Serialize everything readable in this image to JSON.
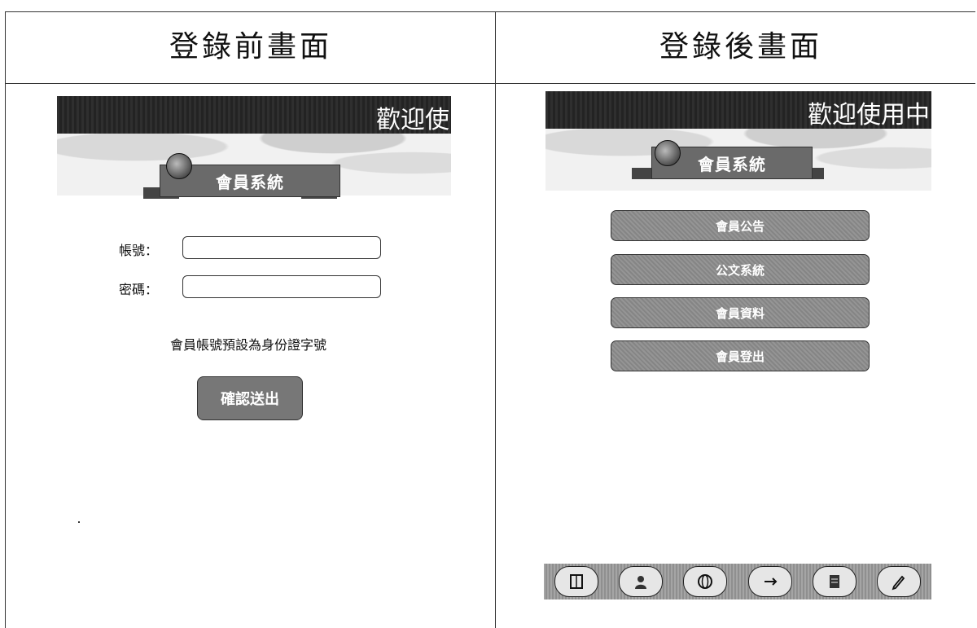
{
  "headings": {
    "before": "登錄前畫面",
    "after": "登錄後畫面"
  },
  "left_panel": {
    "banner_text": "歡迎使",
    "system_title": "會員系統",
    "account_label": "帳號：",
    "password_label": "密碼：",
    "account_value": "",
    "password_value": "",
    "note": "會員帳號預設為身份證字號",
    "submit_label": "確認送出"
  },
  "right_panel": {
    "banner_text": "歡迎使用中",
    "system_title": "會員系統",
    "menu": [
      {
        "label": "會員公告"
      },
      {
        "label": "公文系統"
      },
      {
        "label": "會員資料"
      },
      {
        "label": "會員登出"
      }
    ],
    "toolbar_icons": [
      "book-icon",
      "person-icon",
      "globe-icon",
      "link-icon",
      "document-icon",
      "edit-icon"
    ]
  }
}
